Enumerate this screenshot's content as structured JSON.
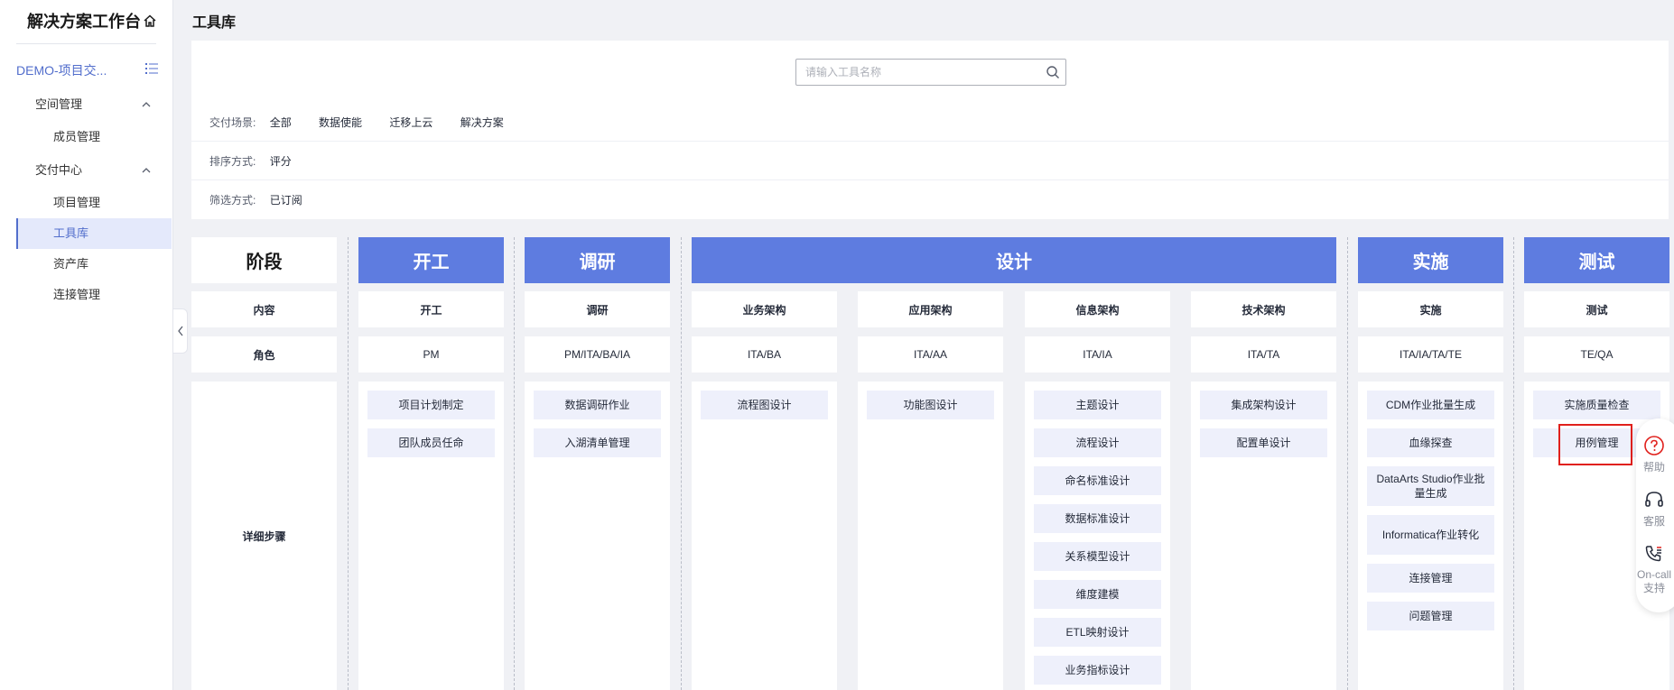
{
  "sidebar": {
    "title": "解决方案工作台",
    "project": "DEMO-项目交...",
    "groups": [
      {
        "label": "空间管理",
        "items": [
          "成员管理"
        ]
      },
      {
        "label": "交付中心",
        "items": [
          "项目管理",
          "工具库",
          "资产库",
          "连接管理"
        ]
      }
    ],
    "active_item": "工具库"
  },
  "header": {
    "title": "工具库"
  },
  "filter": {
    "search_placeholder": "请输入工具名称",
    "scene_label": "交付场景:",
    "scene_options": [
      "全部",
      "数据使能",
      "迁移上云",
      "解决方案"
    ],
    "sort_label": "排序方式:",
    "sort_value": "评分",
    "filter_label": "筛选方式:",
    "filter_value": "已订阅"
  },
  "board": {
    "row_labels": {
      "stage": "阶段",
      "content": "内容",
      "role": "角色",
      "steps": "详细步骤"
    },
    "stages": [
      "开工",
      "调研",
      "设计",
      "实施",
      "测试"
    ],
    "columns": [
      {
        "stage": "开工",
        "content": "开工",
        "role": "PM",
        "steps": [
          "项目计划制定",
          "团队成员任命"
        ]
      },
      {
        "stage": "调研",
        "content": "调研",
        "role": "PM/ITA/BA/IA",
        "steps": [
          "数据调研作业",
          "入湖清单管理"
        ]
      },
      {
        "stage": "设计",
        "content": "业务架构",
        "role": "ITA/BA",
        "steps": [
          "流程图设计"
        ]
      },
      {
        "stage": "设计",
        "content": "应用架构",
        "role": "ITA/AA",
        "steps": [
          "功能图设计"
        ]
      },
      {
        "stage": "设计",
        "content": "信息架构",
        "role": "ITA/IA",
        "steps": [
          "主题设计",
          "流程设计",
          "命名标准设计",
          "数据标准设计",
          "关系模型设计",
          "维度建模",
          "ETL映射设计",
          "业务指标设计"
        ]
      },
      {
        "stage": "设计",
        "content": "技术架构",
        "role": "ITA/TA",
        "steps": [
          "集成架构设计",
          "配置单设计"
        ]
      },
      {
        "stage": "实施",
        "content": "实施",
        "role": "ITA/IA/TA/TE",
        "steps": [
          "CDM作业批量生成",
          "血缘探查",
          "DataArts Studio作业批量生成",
          "Informatica作业转化",
          "连接管理",
          "问题管理"
        ]
      },
      {
        "stage": "测试",
        "content": "测试",
        "role": "TE/QA",
        "steps": [
          "实施质量检查",
          "用例管理"
        ]
      }
    ]
  },
  "float_bar": {
    "help": "帮助",
    "service": "客服",
    "oncall": "On-call支持"
  },
  "colors": {
    "accent": "#5e7ce0",
    "highlight": "#e0201c",
    "step_bg": "#eef0fb",
    "active_bg": "#e4e9fb"
  }
}
